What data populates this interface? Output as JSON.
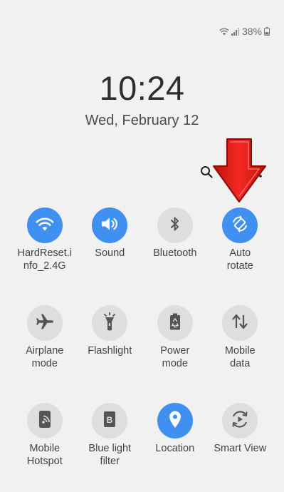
{
  "status": {
    "battery": "38%",
    "icons": [
      "wifi-icon",
      "signal-icon",
      "battery-icon"
    ]
  },
  "lockscreen": {
    "time": "10:24",
    "date": "Wed, February 12"
  },
  "top_actions": {
    "icons": [
      "search-icon",
      "more-options-icon"
    ]
  },
  "accent_color": "#3f90f0",
  "tiles": [
    {
      "label": "HardReset.i\nnfo_2.4G",
      "icon": "wifi-icon",
      "active": true
    },
    {
      "label": "Sound",
      "icon": "volume-icon",
      "active": true
    },
    {
      "label": "Bluetooth",
      "icon": "bluetooth-icon",
      "active": false
    },
    {
      "label": "Auto\nrotate",
      "icon": "auto-rotate-icon",
      "active": true
    },
    {
      "label": "Airplane\nmode",
      "icon": "airplane-icon",
      "active": false
    },
    {
      "label": "Flashlight",
      "icon": "flashlight-icon",
      "active": false
    },
    {
      "label": "Power\nmode",
      "icon": "power-mode-icon",
      "active": false
    },
    {
      "label": "Mobile\ndata",
      "icon": "mobile-data-icon",
      "active": false
    },
    {
      "label": "Mobile\nHotspot",
      "icon": "hotspot-icon",
      "active": false
    },
    {
      "label": "Blue light\nfilter",
      "icon": "blue-light-filter-icon",
      "active": false
    },
    {
      "label": "Location",
      "icon": "location-icon",
      "active": true
    },
    {
      "label": "Smart View",
      "icon": "smart-view-icon",
      "active": false
    }
  ],
  "annotation": {
    "icon": "red-arrow-icon",
    "color": "#e0201c"
  }
}
